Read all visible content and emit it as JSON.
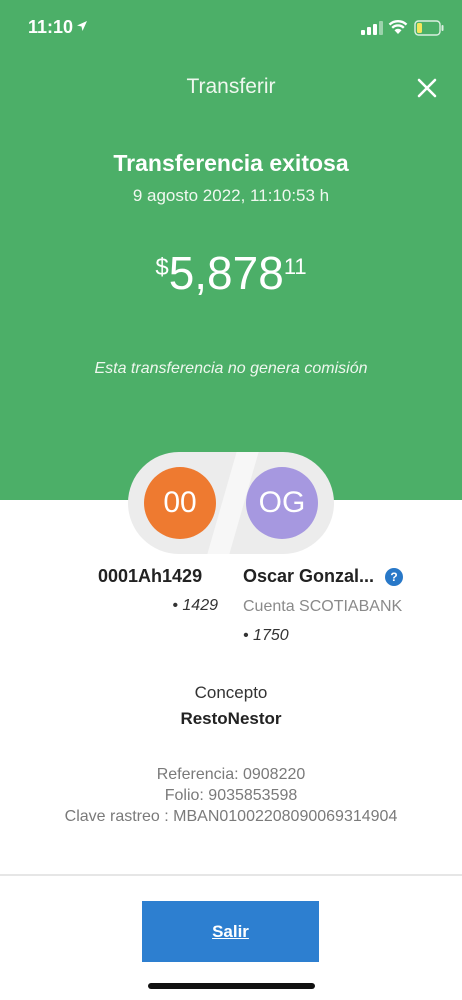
{
  "status_bar": {
    "time": "11:10",
    "icons": [
      "location-arrow-icon",
      "signal-icon",
      "wifi-icon",
      "battery-icon"
    ],
    "battery_color": "#f5e65c"
  },
  "header": {
    "title": "Transferir",
    "close_icon": "close-icon"
  },
  "result": {
    "title": "Transferencia exitosa",
    "date": "9 agosto 2022, 11:10:53 h",
    "amount": {
      "currency_symbol": "$",
      "integer": "5,878",
      "decimals": "11"
    },
    "fee_note": "Esta transferencia no genera comisión"
  },
  "origin": {
    "initials": "00",
    "name": "0001Ah1429",
    "account": "• 1429",
    "color": "#ee7a30"
  },
  "destination": {
    "initials": "OG",
    "name": "Oscar Gonzal...",
    "bank": "Cuenta SCOTIABANK",
    "account": "• 1750",
    "help_icon": "?",
    "color": "#a698e0"
  },
  "concept": {
    "label": "Concepto",
    "value": "RestoNestor"
  },
  "references": {
    "referencia": "Referencia: 0908220",
    "folio": "Folio: 9035853598",
    "clave_rastreo": "Clave rastreo : MBAN01002208090069314904"
  },
  "actions": {
    "exit_label": "Salir"
  },
  "colors": {
    "header_green": "#4caf68",
    "button_blue": "#2d7fd0"
  }
}
